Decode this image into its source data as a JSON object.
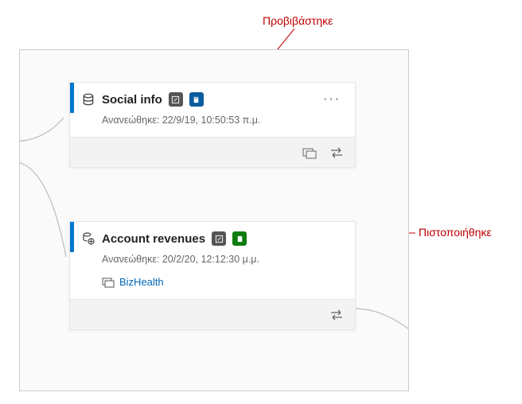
{
  "annotations": {
    "promoted": "Προβιβάστηκε",
    "certified": "Πιστοποιήθηκε"
  },
  "cards": [
    {
      "title": "Social info",
      "refreshed": "Ανανεώθηκε: 22/9/19, 10:50:53 π.μ.",
      "badges": [
        "sensitivity",
        "promoted"
      ],
      "hasMore": true,
      "link": null,
      "footerIcons": [
        "related",
        "lineage"
      ]
    },
    {
      "title": "Account revenues",
      "refreshed": "Ανανεώθηκε: 20/2/20, 12:12:30 μ.μ.",
      "badges": [
        "sensitivity",
        "certified"
      ],
      "hasMore": false,
      "link": "BizHealth",
      "footerIcons": [
        "lineage"
      ]
    }
  ]
}
